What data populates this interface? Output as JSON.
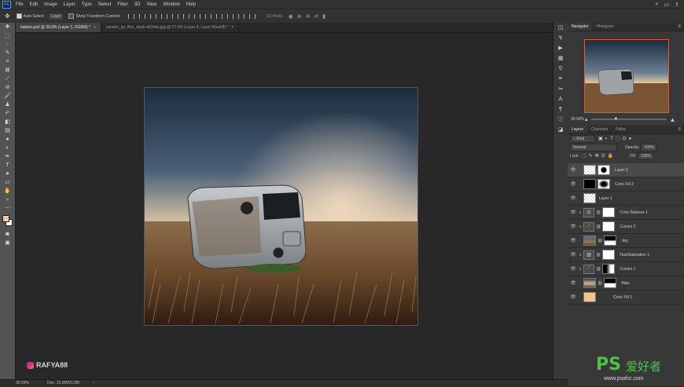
{
  "app": {
    "logo_text": "Ps"
  },
  "menu": [
    "File",
    "Edit",
    "Image",
    "Layer",
    "Type",
    "Select",
    "Filter",
    "3D",
    "View",
    "Window",
    "Help"
  ],
  "options": {
    "auto_select_label": "Auto-Select:",
    "auto_select_value": "Layer",
    "show_transform_label": "Show Transform Controls",
    "mode_3d_label": "3D Mode:"
  },
  "tabs": [
    {
      "label": "baloon.psd @ 30.6% (Layer 2, RGB/8) *",
      "active": true
    },
    {
      "label": "camion_by_fbm_stock-d63ebs.jpg @ 27.5% (Layer 8, Layer Mask/8) *",
      "active": false
    }
  ],
  "watermark": {
    "handle": "RAFYA88"
  },
  "status": {
    "zoom": "30.59%",
    "doc": "Doc: 15.9M/91.3M"
  },
  "navigator": {
    "tabs": [
      "Navigator",
      "Histogram"
    ],
    "zoom": "30.59%"
  },
  "layers_panel": {
    "tabs": [
      "Layers",
      "Channels",
      "Paths"
    ],
    "filter": "Kind",
    "blend_mode": "Normal",
    "opacity_label": "Opacity:",
    "opacity": "100%",
    "lock_label": "Lock:",
    "fill_label": "Fill:",
    "fill": "100%",
    "layers": [
      {
        "name": "Layer 2",
        "type": "pixel-mask",
        "selected": true
      },
      {
        "name": "Color Fill 2",
        "type": "fill-dark"
      },
      {
        "name": "Layer 1",
        "type": "empty"
      },
      {
        "name": "Color Balance 1",
        "type": "adjust"
      },
      {
        "name": "Curves 2",
        "type": "adjust"
      },
      {
        "name": "Jeg.",
        "type": "photo"
      },
      {
        "name": "Hue/Saturation 1",
        "type": "adjust"
      },
      {
        "name": "Curves 1",
        "type": "adjust"
      },
      {
        "name": "Alas.",
        "type": "photo2"
      },
      {
        "name": "Color Fill 1",
        "type": "fill-peach"
      }
    ]
  },
  "site_watermark": {
    "brand": "PS",
    "cn": "爱好者",
    "url": "www.psahz.com"
  },
  "colors": {
    "fg": "#f5c9a0",
    "bg": "#ffffff",
    "accent": "#31a8ff",
    "nav_frame": "#e8552e",
    "fill_peach": "#f6c58e"
  }
}
